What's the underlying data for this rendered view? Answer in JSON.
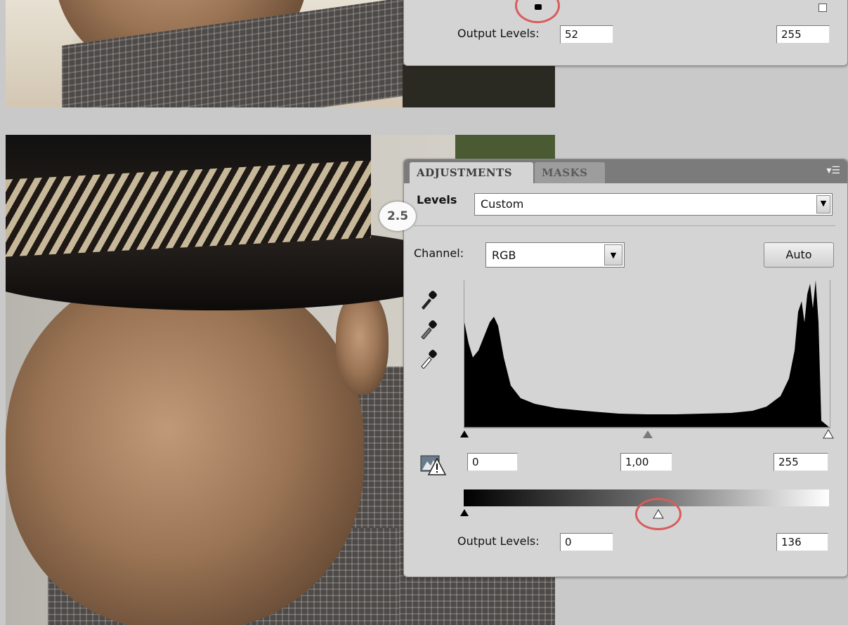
{
  "top_panel": {
    "output_levels_label": "Output Levels:",
    "output_black_value": "52",
    "output_white_value": "255"
  },
  "panel": {
    "tabs": [
      {
        "label": "ADJUSTMENTS",
        "active": true
      },
      {
        "label": "MASKS",
        "active": false
      }
    ],
    "menu_icon": "panel-menu-icon",
    "step_badge": "2.5",
    "adjustment_label": "Levels",
    "preset_value": "Custom",
    "channel_label": "Channel:",
    "channel_value": "RGB",
    "auto_label": "Auto",
    "input_black": "0",
    "input_gamma": "1,00",
    "input_white": "255",
    "output_levels_label": "Output Levels:",
    "output_black": "0",
    "output_white": "136",
    "output_white_fraction": 0.533
  },
  "colors": {
    "panel_bg": "#d4d4d4",
    "tabbar_bg": "#7b7b7b",
    "highlight_ring": "#d85c5c"
  },
  "icons": [
    "black-eyedropper-icon",
    "gray-eyedropper-icon",
    "white-eyedropper-icon",
    "clipping-warning-icon",
    "chevron-down-icon"
  ]
}
